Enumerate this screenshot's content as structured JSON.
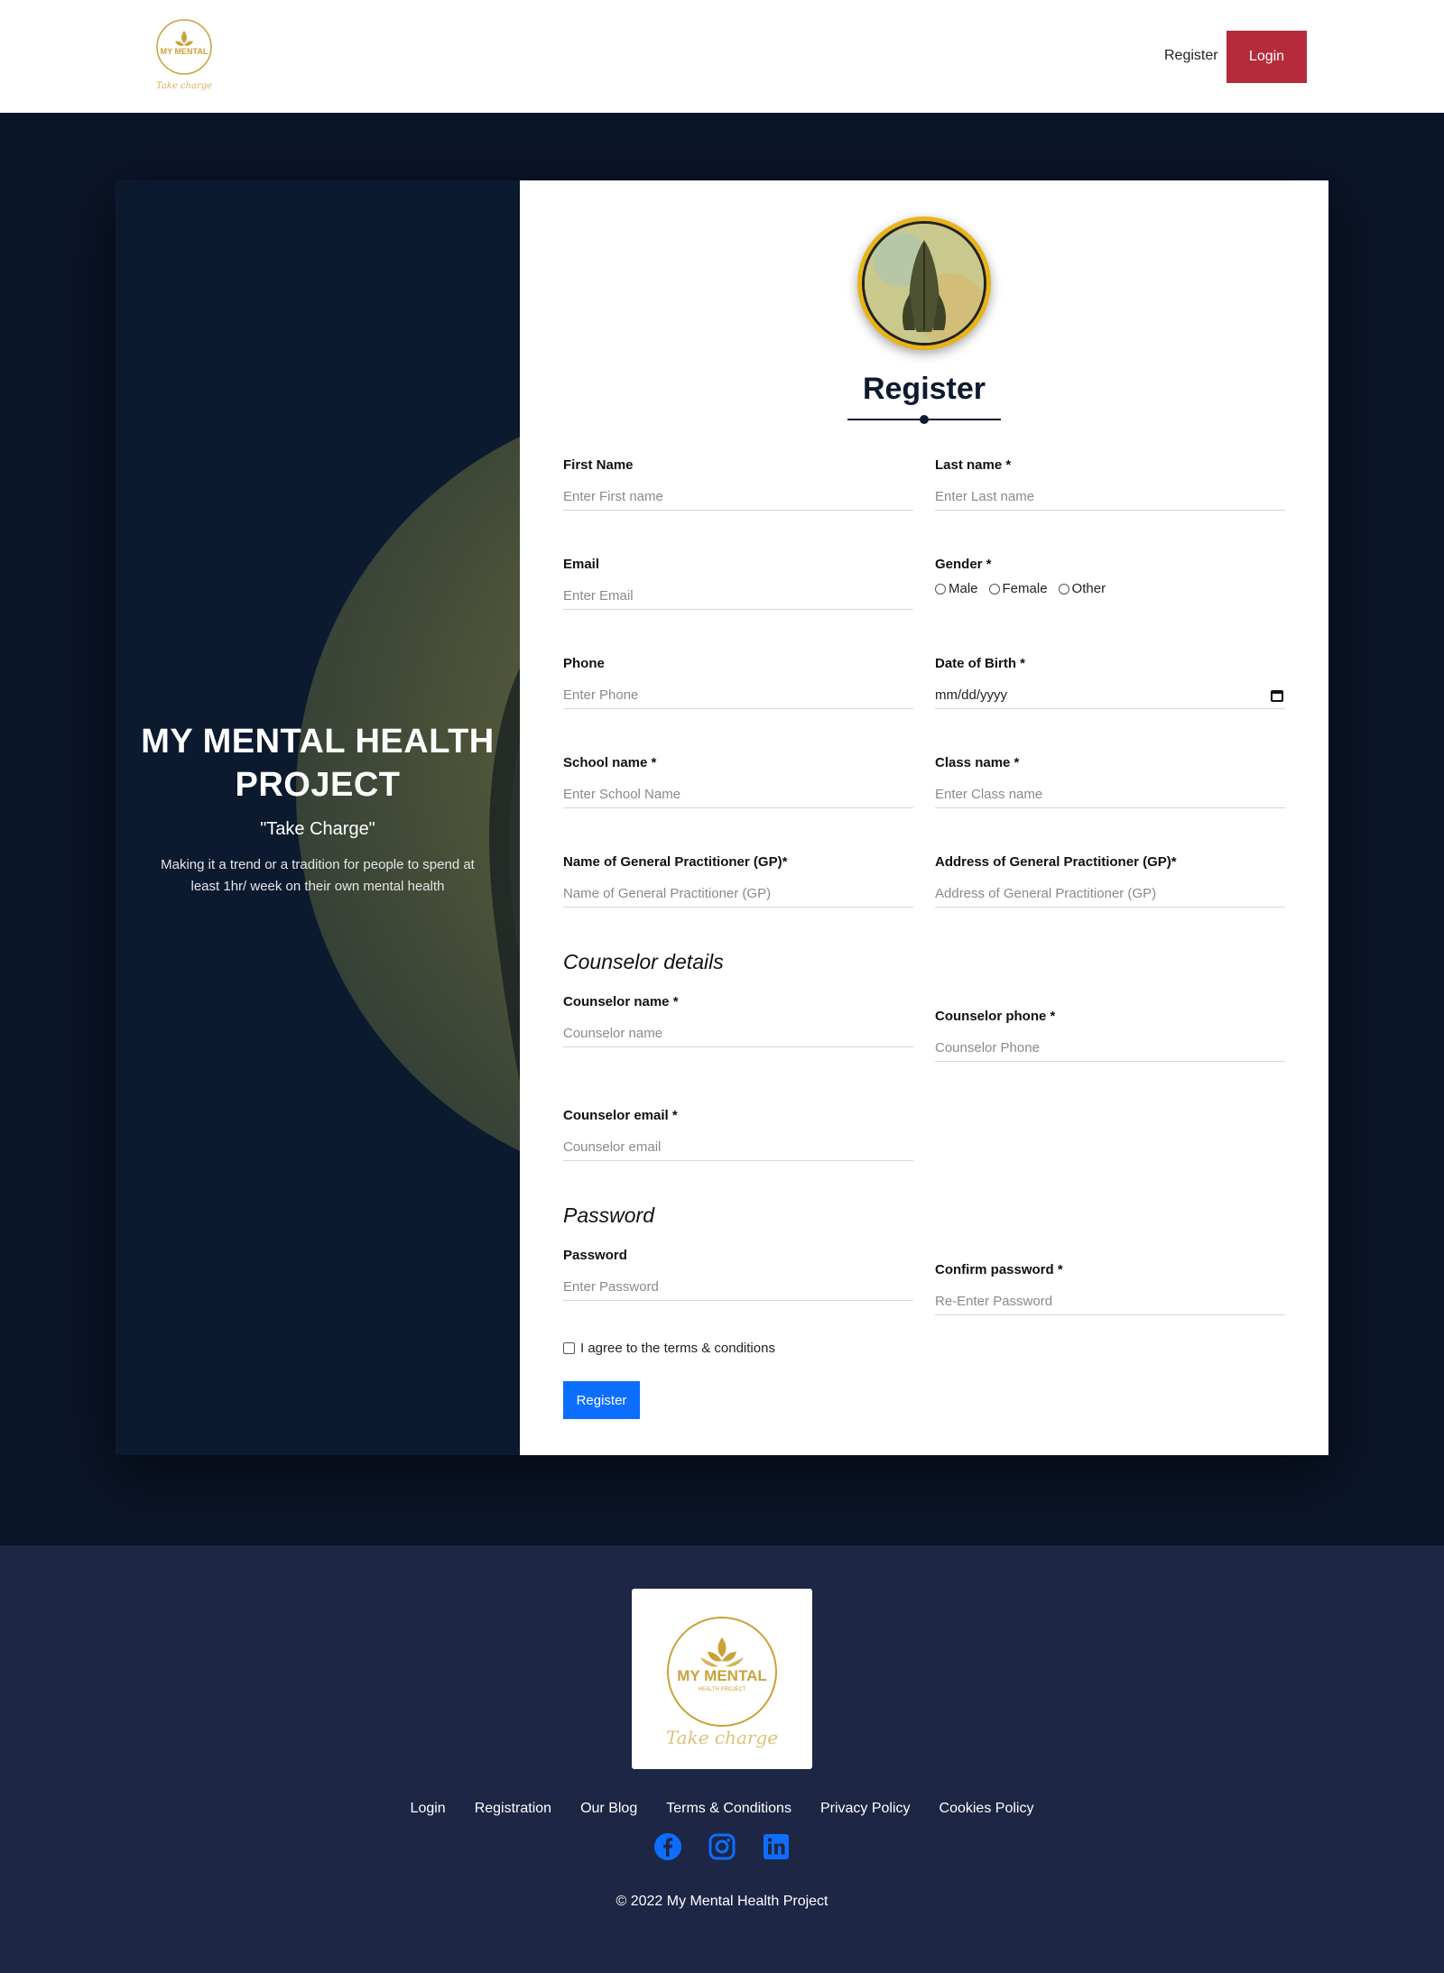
{
  "header": {
    "logo_text": "MY MENTAL",
    "logo_script": "Take charge",
    "nav_register": "Register",
    "login_button": "Login"
  },
  "hero": {
    "title": "MY MENTAL HEALTH PROJECT",
    "tagline": "\"Take Charge\"",
    "description": "Making it a trend or a tradition for people to spend at least 1hr/ week on their own mental health"
  },
  "form": {
    "title": "Register",
    "first_name": {
      "label": "First Name",
      "placeholder": "Enter First name"
    },
    "last_name": {
      "label": "Last name *",
      "placeholder": "Enter Last name"
    },
    "email": {
      "label": "Email",
      "placeholder": "Enter Email"
    },
    "gender": {
      "label": "Gender *",
      "options": [
        "Male",
        "Female",
        "Other"
      ]
    },
    "phone": {
      "label": "Phone",
      "placeholder": "Enter Phone"
    },
    "dob": {
      "label": "Date of Birth *",
      "value": "mm/dd/yyyy"
    },
    "school": {
      "label": "School name *",
      "placeholder": "Enter School Name"
    },
    "class_name": {
      "label": "Class name *",
      "placeholder": "Enter Class name"
    },
    "gp_name": {
      "label": "Name of General Practitioner (GP)*",
      "placeholder": "Name of General Practitioner (GP)"
    },
    "gp_address": {
      "label": "Address of General Practitioner (GP)*",
      "placeholder": "Address of General Practitioner (GP)"
    },
    "counselor_heading": "Counselor details",
    "counselor_name": {
      "label": "Counselor name *",
      "placeholder": "Counselor name"
    },
    "counselor_phone": {
      "label": "Counselor phone *",
      "placeholder": "Counselor Phone"
    },
    "counselor_email": {
      "label": "Counselor email *",
      "placeholder": "Counselor email"
    },
    "password_heading": "Password",
    "password": {
      "label": "Password",
      "placeholder": "Enter Password"
    },
    "confirm_password": {
      "label": "Confirm password *",
      "placeholder": "Re-Enter Password"
    },
    "agree_text": "I agree to the terms & conditions",
    "submit_label": "Register"
  },
  "footer": {
    "logo_text": "MY MENTAL",
    "logo_subtext": "HEALTH PROJECT",
    "logo_script": "Take charge",
    "links": [
      "Login",
      "Registration",
      "Our Blog",
      "Terms & Conditions",
      "Privacy Policy",
      "Cookies Policy"
    ],
    "socials": [
      "facebook-icon",
      "instagram-icon",
      "linkedin-icon"
    ],
    "copyright": "© 2022 My Mental Health Project"
  },
  "colors": {
    "page_bg": "#0b1528",
    "login_button": "#b62b3b",
    "primary_button": "#0d6efd",
    "footer_bg": "#1d2645",
    "gold": "#c9a23a"
  }
}
